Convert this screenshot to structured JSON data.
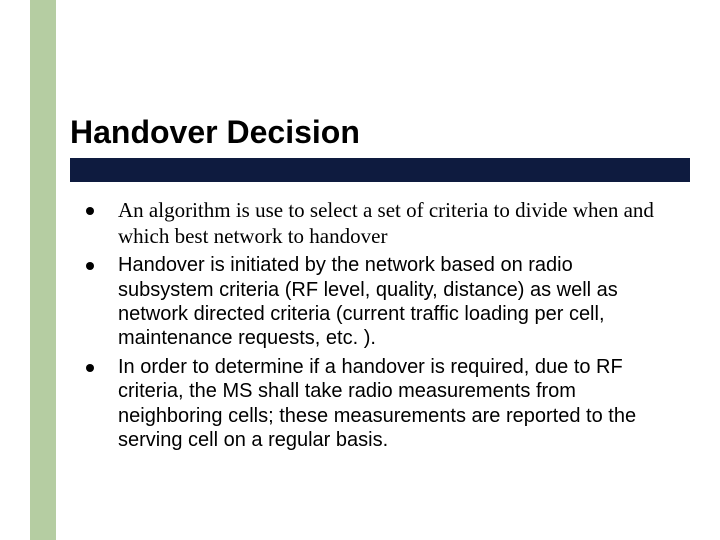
{
  "slide": {
    "title": "Handover Decision",
    "bullets": [
      "An algorithm is use to select a set of criteria to divide when and which best network to handover",
      "Handover is initiated by the network based on radio subsystem criteria (RF level, quality, distance) as well as network directed criteria (current traffic loading per cell, maintenance requests, etc. ).",
      "In order to determine if a handover is required, due to RF criteria, the MS shall take radio measurements from neighboring cells; these measurements are reported to the serving cell on a regular basis."
    ]
  },
  "colors": {
    "side_bar": "#B5CDA2",
    "title_underline": "#0E1B3F"
  }
}
